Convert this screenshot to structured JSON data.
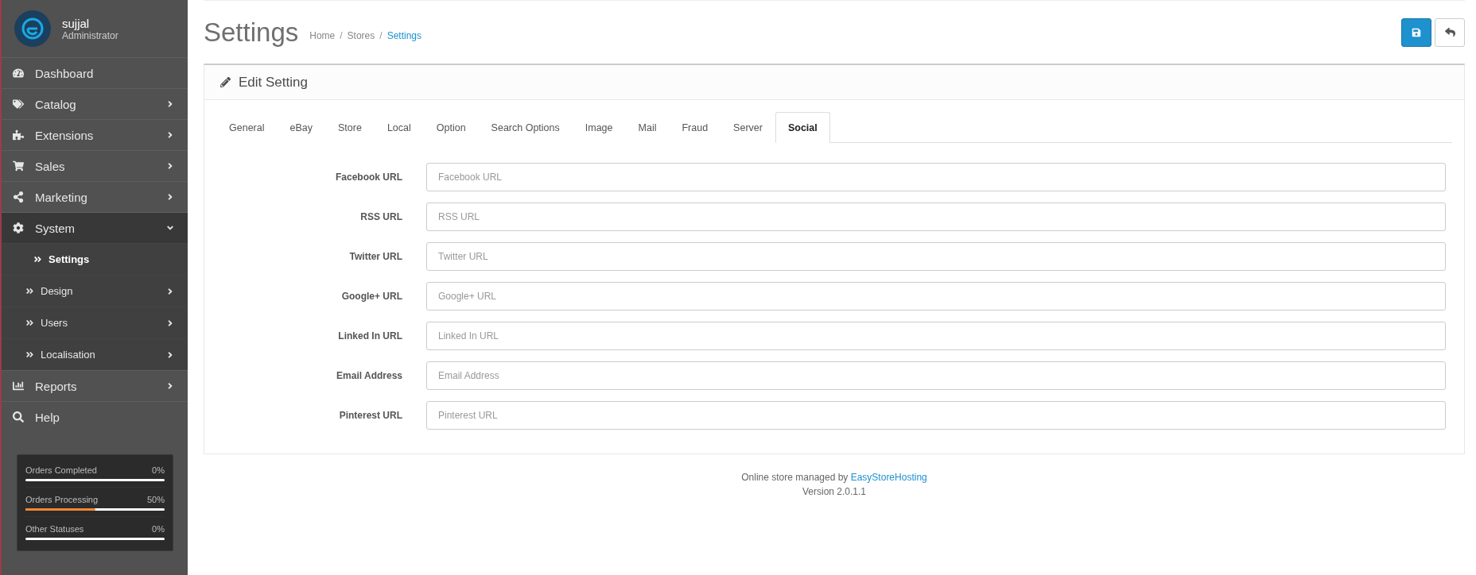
{
  "user": {
    "name": "sujjal",
    "role": "Administrator"
  },
  "menu": [
    {
      "label": "Dashboard"
    },
    {
      "label": "Catalog",
      "expanded": false
    },
    {
      "label": "Extensions",
      "expanded": false
    },
    {
      "label": "Sales",
      "expanded": false
    },
    {
      "label": "Marketing",
      "expanded": false
    },
    {
      "label": "System",
      "expanded": true,
      "children": [
        {
          "label": "Settings",
          "selected": true
        },
        {
          "label": "Design",
          "selected": false,
          "expanded": false
        },
        {
          "label": "Users",
          "selected": false,
          "expanded": false
        },
        {
          "label": "Localisation",
          "selected": false,
          "expanded": false
        }
      ]
    },
    {
      "label": "Reports",
      "expanded": false
    },
    {
      "label": "Help"
    }
  ],
  "order_stats": [
    {
      "label": "Orders Completed",
      "value": "0%",
      "level": 0
    },
    {
      "label": "Orders Processing",
      "value": "50%",
      "level": 0.5
    },
    {
      "label": "Other Statuses",
      "value": "0%",
      "level": 0
    }
  ],
  "page_title": "Settings",
  "breadcrumb": [
    {
      "label": "Home",
      "selected": false
    },
    {
      "separator": "/",
      "label": "Stores",
      "selected": false
    },
    {
      "separator": "/",
      "label": "Settings",
      "selected": true
    }
  ],
  "panel_title": "Edit Setting",
  "tabs": [
    {
      "label": "General",
      "selected": false
    },
    {
      "label": "eBay",
      "selected": false
    },
    {
      "label": "Store",
      "selected": false
    },
    {
      "label": "Local",
      "selected": false
    },
    {
      "label": "Option",
      "selected": false
    },
    {
      "label": "Search Options",
      "selected": false
    },
    {
      "label": "Image",
      "selected": false
    },
    {
      "label": "Mail",
      "selected": false
    },
    {
      "label": "Fraud",
      "selected": false
    },
    {
      "label": "Server",
      "selected": false
    },
    {
      "label": "Social",
      "selected": true
    }
  ],
  "fields": [
    {
      "label": "Facebook URL",
      "placeholder": "Facebook URL"
    },
    {
      "label": "RSS URL",
      "placeholder": "RSS URL"
    },
    {
      "label": "Twitter URL",
      "placeholder": "Twitter URL"
    },
    {
      "label": "Google+ URL",
      "placeholder": "Google+ URL"
    },
    {
      "label": "Linked In URL",
      "placeholder": "Linked In URL"
    },
    {
      "label": "Email Address",
      "placeholder": "Email Address"
    },
    {
      "label": "Pinterest URL",
      "placeholder": "Pinterest URL"
    }
  ],
  "footer": {
    "text": "Online store managed by",
    "link": "EasyStoreHosting",
    "version": "Version 2.0.1.1"
  }
}
